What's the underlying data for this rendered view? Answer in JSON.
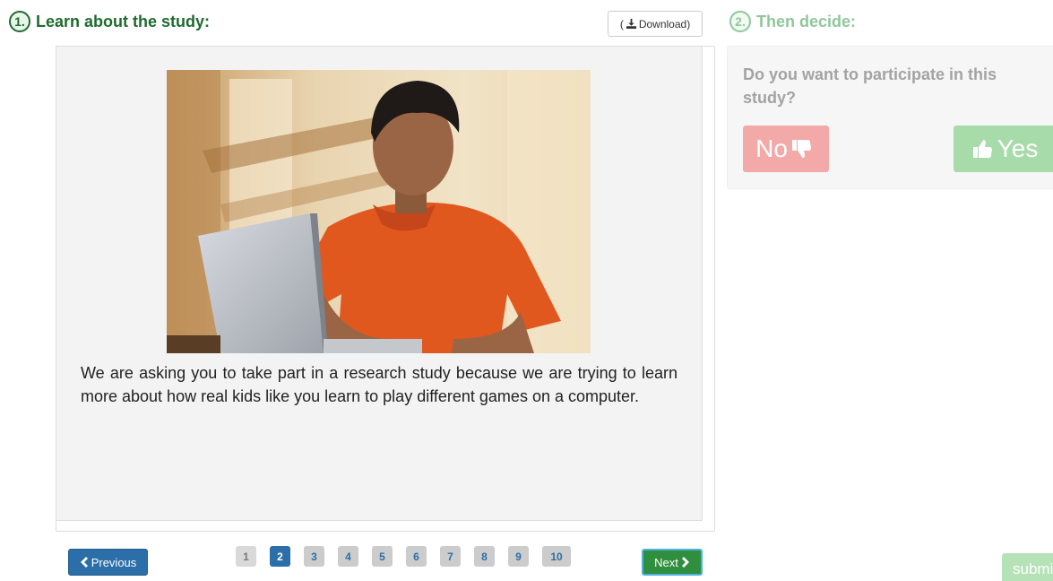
{
  "learn": {
    "step_number": "1.",
    "title": "Learn about the study:",
    "download_label": "Download",
    "image_alt": "photo-of-boy-using-laptop",
    "body_text": "We are asking you to take part in a research study because we are trying to learn more about how real kids like you learn to play different games on a computer."
  },
  "pagination": {
    "previous_label": "Previous",
    "next_label": "Next",
    "pages": [
      "1",
      "2",
      "3",
      "4",
      "5",
      "6",
      "7",
      "8",
      "9",
      "10"
    ],
    "current_page": "2"
  },
  "decide": {
    "step_number": "2.",
    "title": "Then decide:",
    "question": "Do you want to participate in this study?",
    "no_label": "No",
    "yes_label": "Yes",
    "submit_label": "submit"
  },
  "icons": {
    "download": "download-icon",
    "previous": "chevron-left-icon",
    "next": "chevron-right-icon",
    "no": "thumbs-down-icon",
    "yes": "thumbs-up-icon"
  },
  "colors": {
    "primary_blue": "#2b6ea8",
    "green": "#2f8f3e",
    "heading_green": "#1e6b2e",
    "no_red": "#f2a9a8",
    "yes_green": "#a7dba9"
  }
}
